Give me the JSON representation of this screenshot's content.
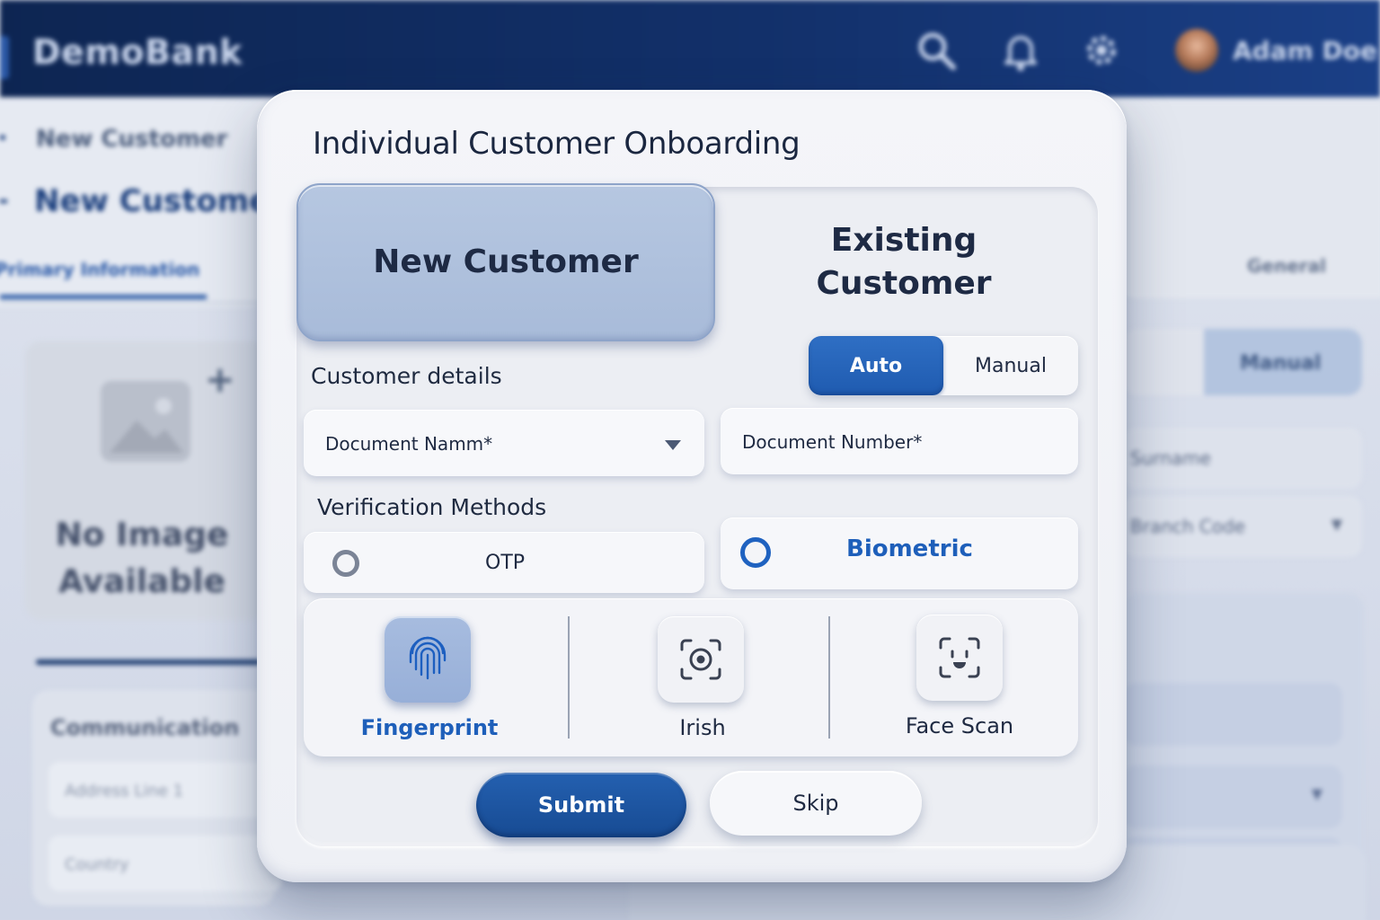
{
  "app": {
    "brand": "DemoBank",
    "user_name": "Adam Doe",
    "icons": [
      "search-icon",
      "bell-icon",
      "gear-icon"
    ]
  },
  "background": {
    "crumb_small": "New Customer",
    "crumb_large": "New Customer",
    "left_tab": "Primary Information",
    "no_image": "No Image Available",
    "communication_title": "Communication",
    "address_placeholder": "Address Line 1",
    "country_placeholder": "Country",
    "right_tab": "General",
    "right_toggle_label": "Manual",
    "right_field_1": "Surname",
    "right_field_2": "Branch Code"
  },
  "modal": {
    "title": "Individual Customer Onboarding",
    "new_customer": "New Customer",
    "existing_customer": "Existing Customer",
    "mode_auto": "Auto",
    "mode_manual": "Manual",
    "customer_details_label": "Customer details",
    "document_name": "Document Namm*",
    "document_number": "Document Number*",
    "verification_label": "Verification Methods",
    "otp": "OTP",
    "biometric": "Biometric",
    "fingerprint": "Fingerprint",
    "iris": "Irish",
    "face_scan": "Face Scan",
    "submit": "Submit",
    "skip": "Skip"
  },
  "colors": {
    "accent": "#1e5fba",
    "primary_button": "#1c539f",
    "topbar": "#0d2552",
    "selected_card": "#afc1de"
  },
  "state": {
    "selected_customer_type": "New Customer",
    "selected_mode": "Auto",
    "selected_verification": "Biometric",
    "selected_biometric": "Fingerprint"
  }
}
